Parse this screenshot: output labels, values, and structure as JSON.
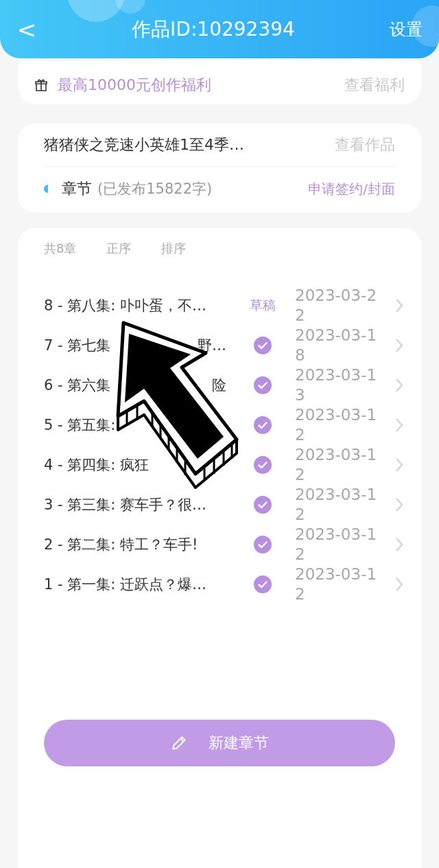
{
  "header": {
    "back": "<",
    "title": "作品ID:10292394",
    "settings": "设置"
  },
  "benefit": {
    "text": "最高10000元创作福利",
    "link": "查看福利"
  },
  "work": {
    "title": "猪猪侠之竞速小英雄1至4季…",
    "link": "查看作品",
    "section": "章节",
    "published": "(已发布15822字)",
    "action": "申请签约/封面"
  },
  "chapters": {
    "count": "共8章",
    "order": "正序",
    "sort": "排序",
    "rows": [
      {
        "title": "8 - 第八集: 卟卟蛋，不…",
        "kind": "draft",
        "status_label": "草稿",
        "date": "2023-03-22"
      },
      {
        "title": "7 - 第七集",
        "tail": "野…",
        "kind": "published",
        "date": "2023-03-18"
      },
      {
        "title": "6 - 第六集",
        "tail": "险",
        "kind": "published",
        "date": "2023-03-13"
      },
      {
        "title": "5 - 第五集:",
        "kind": "published",
        "date": "2023-03-12"
      },
      {
        "title": "4 - 第四集: 疯狂",
        "kind": "published",
        "date": "2023-03-12"
      },
      {
        "title": "3 - 第三集: 赛车手？很…",
        "kind": "published",
        "date": "2023-03-12"
      },
      {
        "title": "2 - 第二集: 特工？车手!",
        "kind": "published",
        "date": "2023-03-12"
      },
      {
        "title": "1 - 第一集: 迁跃点？爆…",
        "kind": "published",
        "date": "2023-03-12"
      }
    ]
  },
  "new_button": "新建章节"
}
